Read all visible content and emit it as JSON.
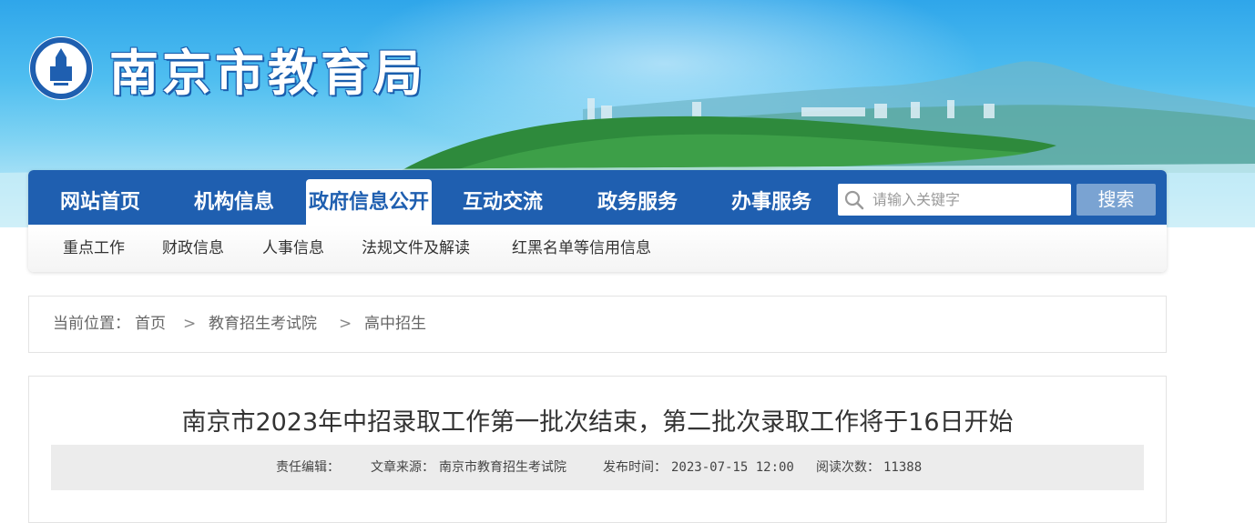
{
  "site": {
    "title": "南京市教育局",
    "logo_icon": "nanjing-education-emblem-icon",
    "accent_color": "#1f5fb0"
  },
  "nav": {
    "items": [
      {
        "label": "网站首页",
        "active": false
      },
      {
        "label": "机构信息",
        "active": false
      },
      {
        "label": "政府信息公开",
        "active": true
      },
      {
        "label": "互动交流",
        "active": false
      },
      {
        "label": "政务服务",
        "active": false
      },
      {
        "label": "办事服务",
        "active": false
      }
    ],
    "search": {
      "placeholder": "请输入关键字",
      "value": "",
      "icon": "search-icon",
      "button_label": "搜索"
    }
  },
  "sub_nav": {
    "items": [
      "重点工作",
      "财政信息",
      "人事信息",
      "法规文件及解读",
      "红黑名单等信用信息"
    ]
  },
  "breadcrumb": {
    "prefix": "当前位置：",
    "items": [
      "首页",
      "教育招生考试院",
      "高中招生"
    ],
    "separator": ">"
  },
  "article": {
    "title": "南京市2023年中招录取工作第一批次结束，第二批次录取工作将于16日开始",
    "meta": {
      "editor_label": "责任编辑：",
      "editor_value": "",
      "source_label": "文章来源：",
      "source_value": "南京市教育招生考试院",
      "time_label": "发布时间：",
      "time_value": "2023-07-15 12:00",
      "views_label": "阅读次数：",
      "views_value": "11388"
    }
  }
}
